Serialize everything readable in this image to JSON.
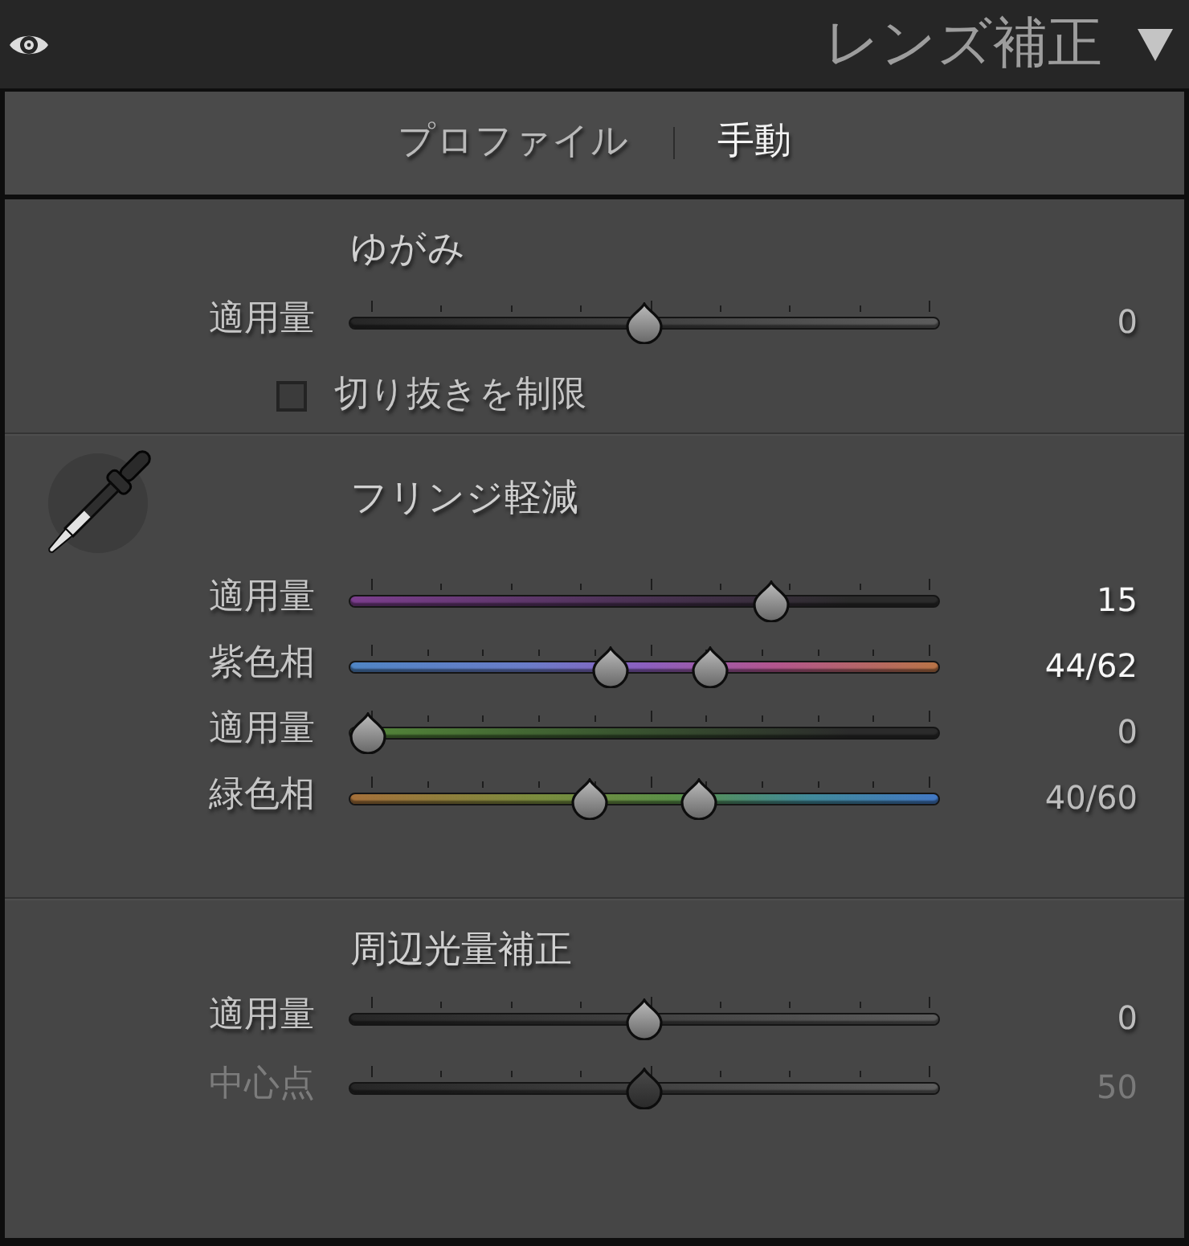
{
  "header": {
    "title": "レンズ補正"
  },
  "tabs": [
    {
      "label": "プロファイル",
      "selected": false
    },
    {
      "label": "手動",
      "selected": true
    }
  ],
  "distortion": {
    "title": "ゆがみ",
    "sliders": [
      {
        "label": "適用量",
        "kind": "plain",
        "thumbs": [
          {
            "level": 0.5
          }
        ],
        "value": "0",
        "highlighted": false,
        "disabled": false
      }
    ],
    "checkbox": {
      "label": "切り抜きを制限",
      "checked": false
    }
  },
  "fringe": {
    "title": "フリンジ軽減",
    "sliders": [
      {
        "label": "適用量",
        "kind": "purple",
        "thumbs": [
          {
            "level": 0.73
          }
        ],
        "value": "15",
        "highlighted": true,
        "disabled": false
      },
      {
        "label": "紫色相",
        "kind": "purplehue",
        "thumbs": [
          {
            "level": 0.44
          },
          {
            "level": 0.62
          }
        ],
        "value": "44/62",
        "highlighted": true,
        "disabled": false
      },
      {
        "label": "適用量",
        "kind": "green",
        "thumbs": [
          {
            "level": 0
          }
        ],
        "value": "0",
        "highlighted": false,
        "disabled": false
      },
      {
        "label": "緑色相",
        "kind": "greenhue",
        "thumbs": [
          {
            "level": 0.4
          },
          {
            "level": 0.6
          }
        ],
        "value": "40/60",
        "highlighted": false,
        "disabled": false
      }
    ]
  },
  "vignetting": {
    "title": "周辺光量補正",
    "sliders": [
      {
        "label": "適用量",
        "kind": "plain",
        "thumbs": [
          {
            "level": 0.5
          }
        ],
        "value": "0",
        "highlighted": false,
        "disabled": false
      },
      {
        "label": "中心点",
        "kind": "plain",
        "thumbs": [
          {
            "level": 0.5
          }
        ],
        "value": "50",
        "highlighted": false,
        "disabled": true
      }
    ]
  }
}
